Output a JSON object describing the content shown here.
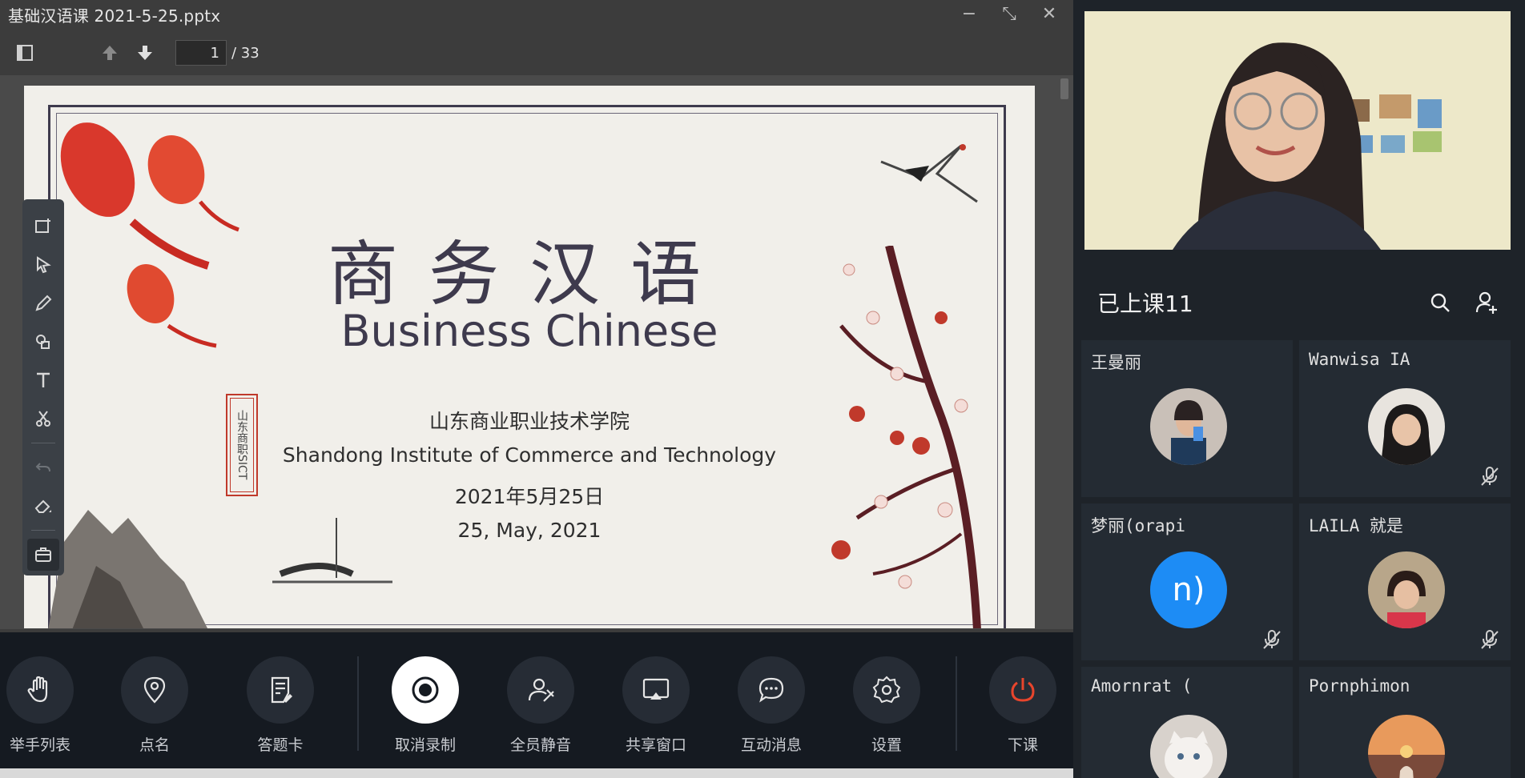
{
  "window": {
    "title": "基础汉语课 2021-5-25.pptx",
    "minimize_glyph": "−",
    "restore_glyph": "⤡",
    "close_glyph": "✕"
  },
  "toolbar": {
    "current_page": "1",
    "total_pages": "/ 33",
    "icons": [
      "sidebar-toggle-icon",
      "arrow-up-icon",
      "arrow-down-icon"
    ]
  },
  "slide": {
    "title_cn": "商务汉语",
    "title_en": "Business Chinese",
    "school_cn": "山东商业职业技术学院",
    "school_en": "Shandong Institute of Commerce and Technology",
    "date_cn": "2021年5月25日",
    "date_en": "25, May, 2021",
    "seal_text": "山东商职SICT"
  },
  "annotation_tools": [
    "add-slide-icon",
    "pointer-icon",
    "pen-icon",
    "shapes-icon",
    "text-icon",
    "scissors-icon",
    "undo-icon",
    "eraser-icon",
    "toolbox-icon"
  ],
  "controls": {
    "raise_hand": "举手列表",
    "roll_call": "点名",
    "answer_card": "答题卡",
    "stop_recording": "取消录制",
    "mute_all": "全员静音",
    "share_window": "共享窗口",
    "chat": "互动消息",
    "settings": "设置",
    "end_class": "下课"
  },
  "roster": {
    "title": "已上课11",
    "participants": [
      {
        "name": "王曼丽",
        "muted": false
      },
      {
        "name": "Wanwisa IA",
        "muted": true
      },
      {
        "name": "梦丽(orapi",
        "avatar_text": "n)",
        "muted": true
      },
      {
        "name": "LAILA 就是",
        "muted": true
      },
      {
        "name": "Amornrat (",
        "muted": false
      },
      {
        "name": "Pornphimon",
        "muted": false
      }
    ]
  },
  "colors": {
    "accent_blue": "#1d8cf5",
    "end_red": "#e8452c",
    "panel_bg": "#1e2329",
    "control_bg": "#151a21"
  }
}
